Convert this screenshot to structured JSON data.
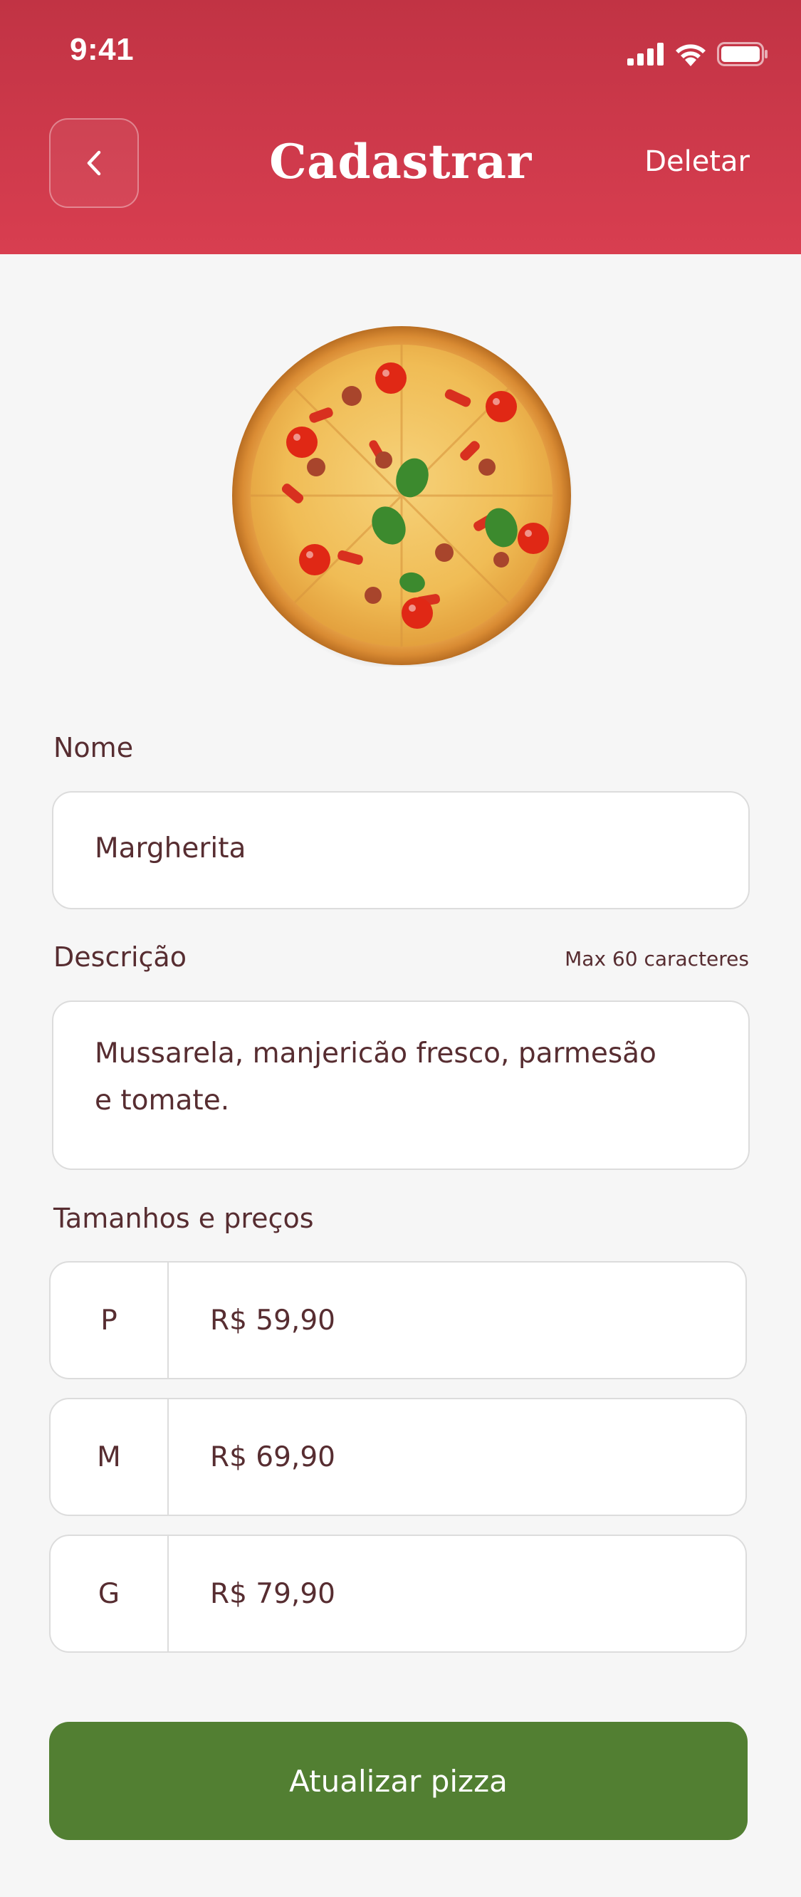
{
  "status_bar": {
    "time": "9:41"
  },
  "header": {
    "title": "Cadastrar",
    "delete_label": "Deletar",
    "back_icon": "chevron-left-icon"
  },
  "colors": {
    "header_top": "#C13344",
    "header_bottom": "#D83E50",
    "background": "#F6F6F6",
    "text": "#572D31",
    "button": "#527F32",
    "border": "#DCDCDC"
  },
  "form": {
    "name": {
      "label": "Nome",
      "value": "Margherita"
    },
    "description": {
      "label": "Descrição",
      "hint": "Max 60 caracteres",
      "value": "Mussarela, manjericão fresco, parmesão e tomate."
    },
    "sizes": {
      "label": "Tamanhos e preços",
      "items": [
        {
          "size": "P",
          "price": "R$ 59,90"
        },
        {
          "size": "M",
          "price": "R$ 69,90"
        },
        {
          "size": "G",
          "price": "R$ 79,90"
        }
      ]
    },
    "submit_label": "Atualizar pizza"
  }
}
